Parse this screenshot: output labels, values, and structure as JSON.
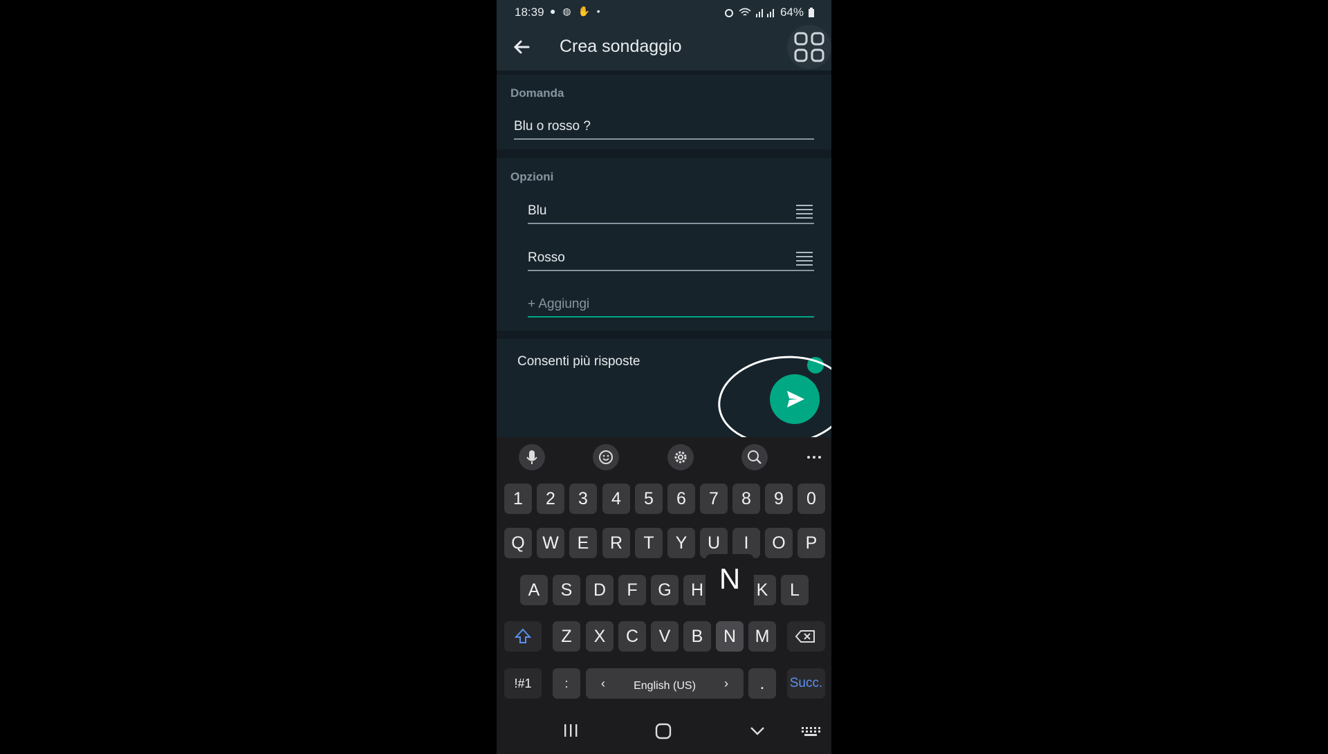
{
  "status": {
    "time": "18:39",
    "battery": "64%"
  },
  "header": {
    "title": "Crea sondaggio"
  },
  "question": {
    "label": "Domanda",
    "value": "Blu o rosso ?"
  },
  "options": {
    "label": "Opzioni",
    "items": [
      {
        "value": "Blu"
      },
      {
        "value": "Rosso"
      }
    ],
    "add_placeholder": "+ Aggiungi"
  },
  "multiple_answers": {
    "label": "Consenti più risposte",
    "enabled": true
  },
  "keyboard": {
    "number_row": [
      "1",
      "2",
      "3",
      "4",
      "5",
      "6",
      "7",
      "8",
      "9",
      "0"
    ],
    "row1": [
      "Q",
      "W",
      "E",
      "R",
      "T",
      "Y",
      "U",
      "I",
      "O",
      "P"
    ],
    "row2": [
      "A",
      "S",
      "D",
      "F",
      "G",
      "H",
      "N",
      "K",
      "L"
    ],
    "row3": [
      "Z",
      "X",
      "C",
      "V",
      "B",
      "N",
      "M"
    ],
    "symbols_label": "!#1",
    "colon_label": ":",
    "language_label": "English (US)",
    "period_label": ".",
    "next_label": "Succ.",
    "popup_key": "N"
  },
  "colors": {
    "accent": "#00a884",
    "background": "#121b22"
  }
}
